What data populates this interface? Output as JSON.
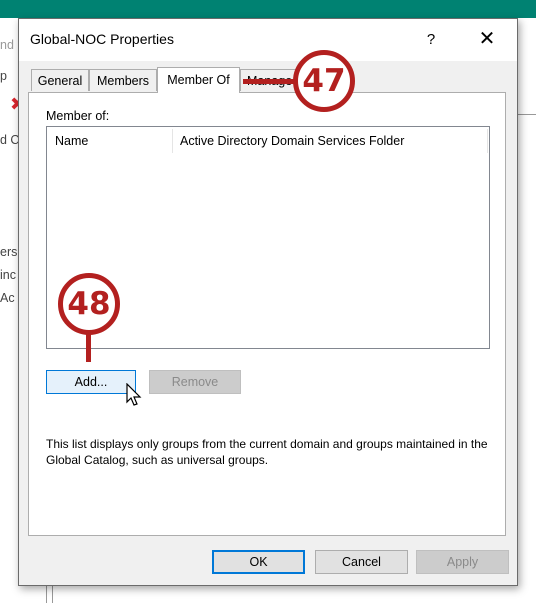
{
  "background": {
    "fragments": [
      "nd",
      "p",
      "d C",
      "ers",
      "inc",
      "Ac"
    ]
  },
  "dialog": {
    "title": "Global-NOC Properties",
    "help_label": "?",
    "close_label": "✕",
    "tabs": [
      {
        "label": "General"
      },
      {
        "label": "Members"
      },
      {
        "label": "Member Of"
      },
      {
        "label": "Manage"
      }
    ],
    "member_of_label": "Member of:",
    "columns": [
      "Name",
      "Active Directory Domain Services Folder"
    ],
    "buttons": {
      "add": "Add...",
      "remove": "Remove",
      "ok": "OK",
      "cancel": "Cancel",
      "apply": "Apply"
    },
    "info_text": "This list displays only groups from the current domain and groups maintained in the Global Catalog, such as universal groups."
  },
  "callouts": [
    {
      "number": "47"
    },
    {
      "number": "48"
    }
  ],
  "colors": {
    "accent": "#0078d7",
    "callout": "#b3201f",
    "header_bar": "#008272"
  }
}
